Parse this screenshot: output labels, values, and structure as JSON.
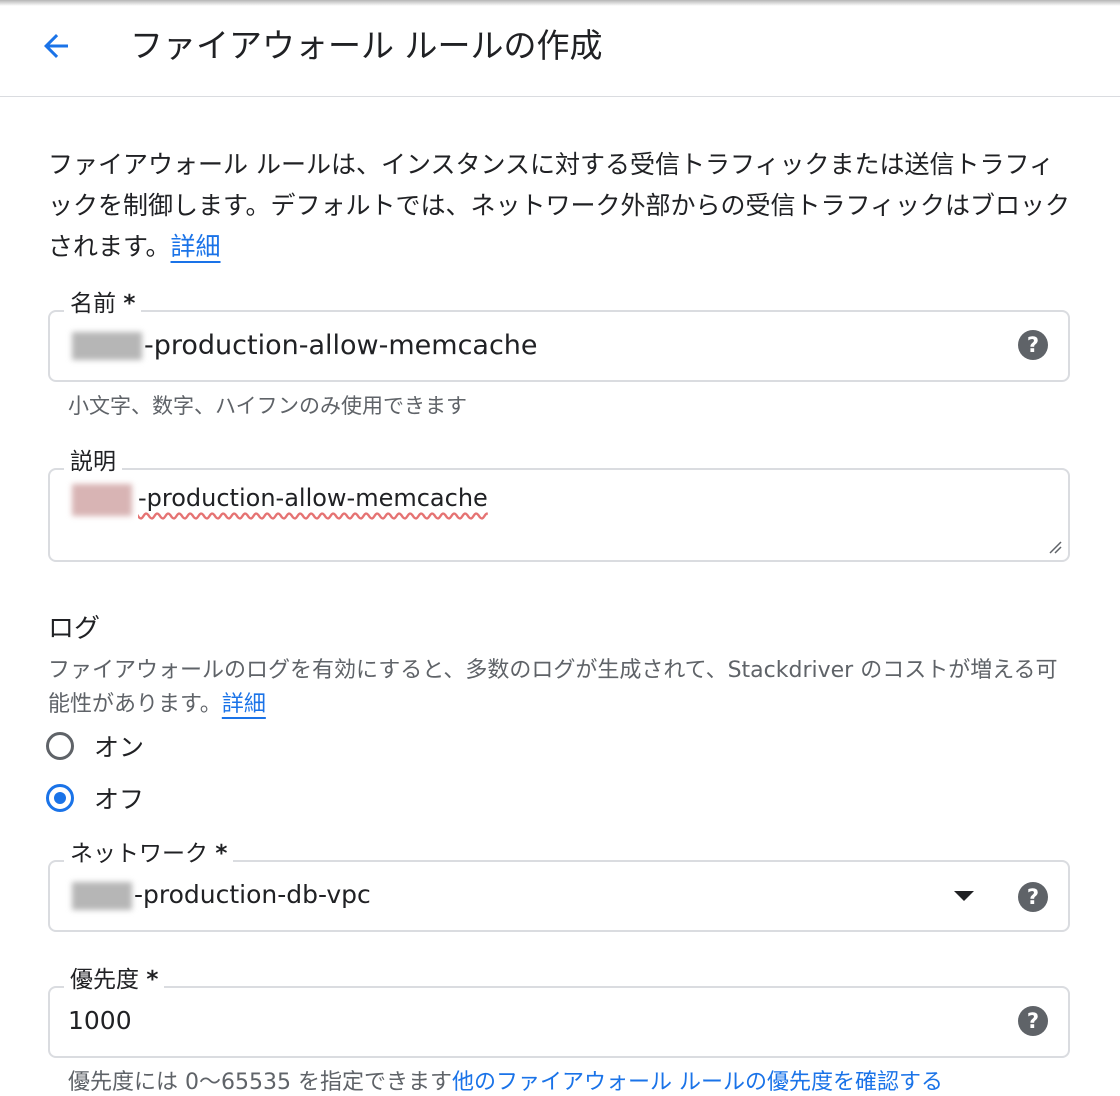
{
  "header": {
    "back_icon": "arrow-back-icon",
    "title": "ファイアウォール ルールの作成"
  },
  "intro": {
    "text": "ファイアウォール ルールは、インスタンスに対する受信トラフィックまたは送信トラフィックを制御します。デフォルトでは、ネットワーク外部からの受信トラフィックはブロックされます。",
    "link": "詳細"
  },
  "name_field": {
    "label": "名前",
    "required_mark": "*",
    "value": "-production-allow-memcache",
    "hint": "小文字、数字、ハイフンのみ使用できます",
    "help_icon": "help-icon"
  },
  "description_field": {
    "label": "説明",
    "value": "-production-allow-memcache"
  },
  "logs": {
    "title": "ログ",
    "description": "ファイアウォールのログを有効にすると、多数のログが生成されて、Stackdriver のコストが増える可能性があります。",
    "link": "詳細",
    "options": [
      {
        "label": "オン",
        "selected": false
      },
      {
        "label": "オフ",
        "selected": true
      }
    ]
  },
  "network_field": {
    "label": "ネットワーク",
    "required_mark": "*",
    "value": "-production-db-vpc",
    "help_icon": "help-icon",
    "dropdown_icon": "arrow-drop-down-icon"
  },
  "priority_field": {
    "label": "優先度",
    "required_mark": "*",
    "value": "1000",
    "hint": "優先度には 0〜65535 を指定できます",
    "hint_link": "他のファイアウォール ルールの優先度を確認する",
    "help_icon": "help-icon"
  },
  "colors": {
    "accent": "#1a73e8",
    "border": "#dadce0",
    "text": "#202124",
    "secondary_text": "#5f6368"
  }
}
